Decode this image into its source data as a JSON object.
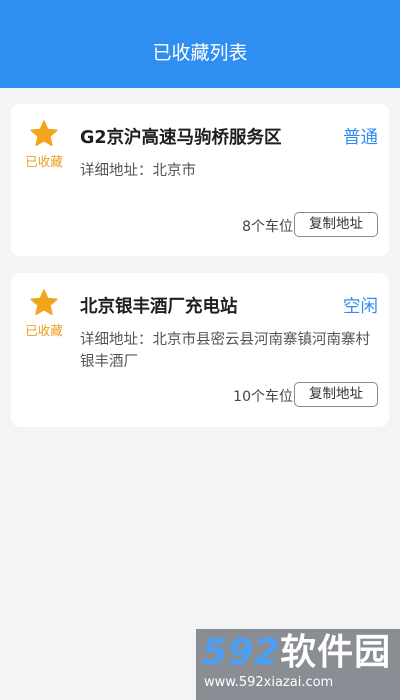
{
  "header": {
    "title": "已收藏列表"
  },
  "colors": {
    "accent": "#2f8ef2",
    "star": "#f2a51a",
    "fav_label": "#e8a020"
  },
  "favorites": [
    {
      "fav_icon": "star-icon",
      "fav_label": "已收藏",
      "name": "G2京沪高速马驹桥服务区",
      "status": "普通",
      "address": "详细地址：北京市",
      "spaces": "8个车位",
      "copy_label": "复制地址"
    },
    {
      "fav_icon": "star-icon",
      "fav_label": "已收藏",
      "name": "北京银丰酒厂充电站",
      "status": "空闲",
      "address": "详细地址：北京市县密云县河南寨镇河南寨村银丰酒厂",
      "spaces": "10个车位",
      "copy_label": "复制地址"
    }
  ],
  "watermark": {
    "brand_num": "592",
    "brand_cn": "软件园",
    "url": "www.592xiazai.com"
  }
}
